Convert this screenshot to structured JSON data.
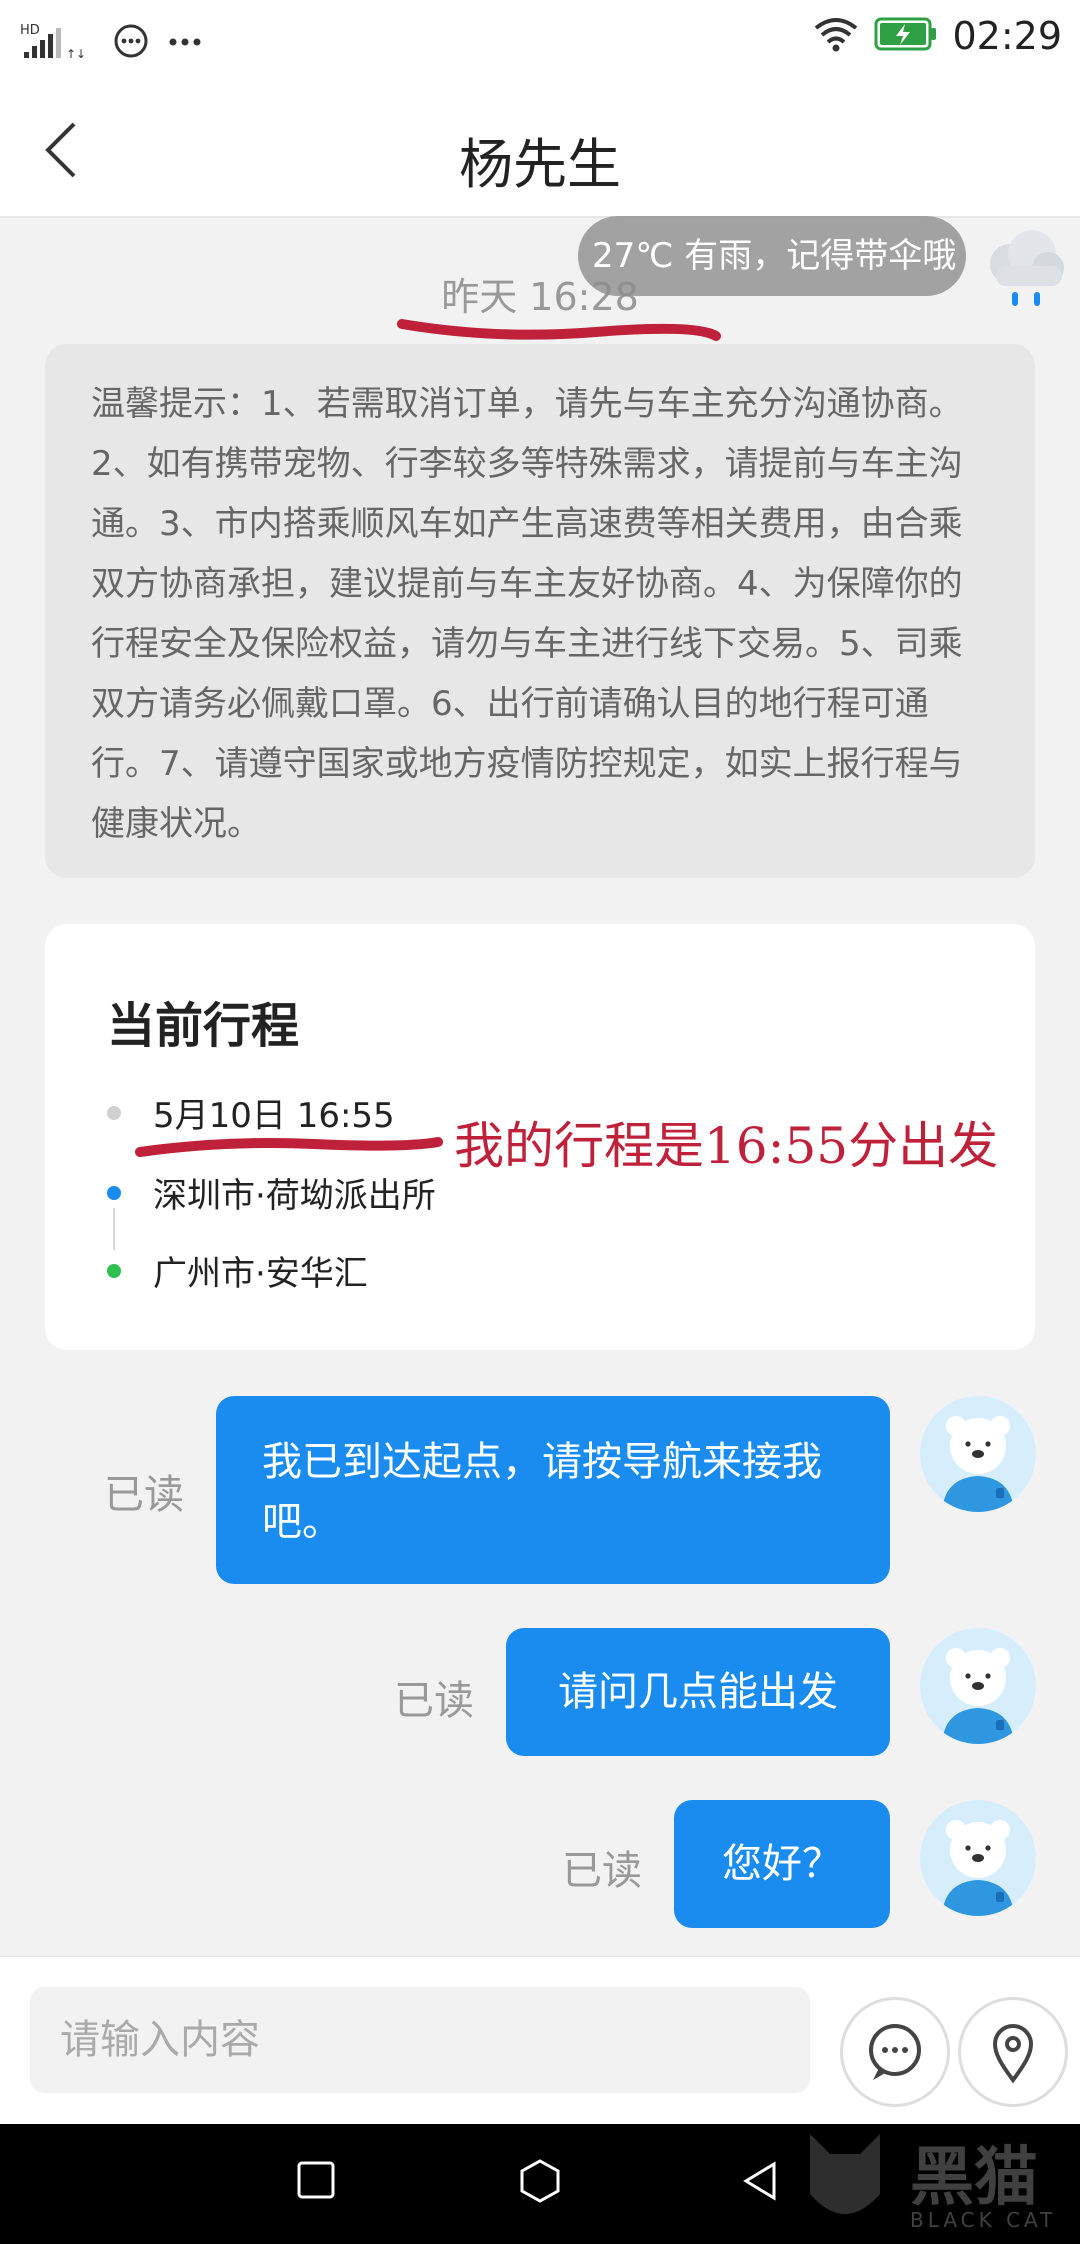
{
  "statusbar": {
    "network": "HD",
    "time": "02:29"
  },
  "header": {
    "title": "杨先生"
  },
  "weather": {
    "text": "27℃ 有雨，记得带伞哦"
  },
  "chat": {
    "timestamp": "昨天  16:28",
    "tips": "温馨提示：1、若需取消订单，请先与车主充分沟通协商。2、如有携带宠物、行李较多等特殊需求，请提前与车主沟通。3、市内搭乘顺风车如产生高速费等相关费用，由合乘双方协商承担，建议提前与车主友好协商。4、为保障你的行程安全及保险权益，请勿与车主进行线下交易。5、司乘双方请务必佩戴口罩。6、出行前请确认目的地行程可通行。7、请遵守国家或地方疫情防控规定，如实上报行程与健康状况。",
    "trip": {
      "title": "当前行程",
      "time": "5月10日 16:55",
      "from": "深圳市·荷坳派出所",
      "to": "广州市·安华汇"
    },
    "annotation": "我的行程是16:55分出发",
    "messages": [
      {
        "text": "我已到达起点，请按导航来接我吧。",
        "status": "已读"
      },
      {
        "text": "请问几点能出发",
        "status": "已读"
      },
      {
        "text": "您好？",
        "status": "已读"
      }
    ]
  },
  "input": {
    "placeholder": "请输入内容"
  },
  "watermark": {
    "text": "黑猫",
    "sub": "BLACK CAT"
  },
  "colors": {
    "bubble": "#1a8cf0",
    "annotation": "#c0213a",
    "dot_time": "#d0d0d0",
    "dot_from": "#1a8cf0",
    "dot_to": "#2ec050"
  }
}
